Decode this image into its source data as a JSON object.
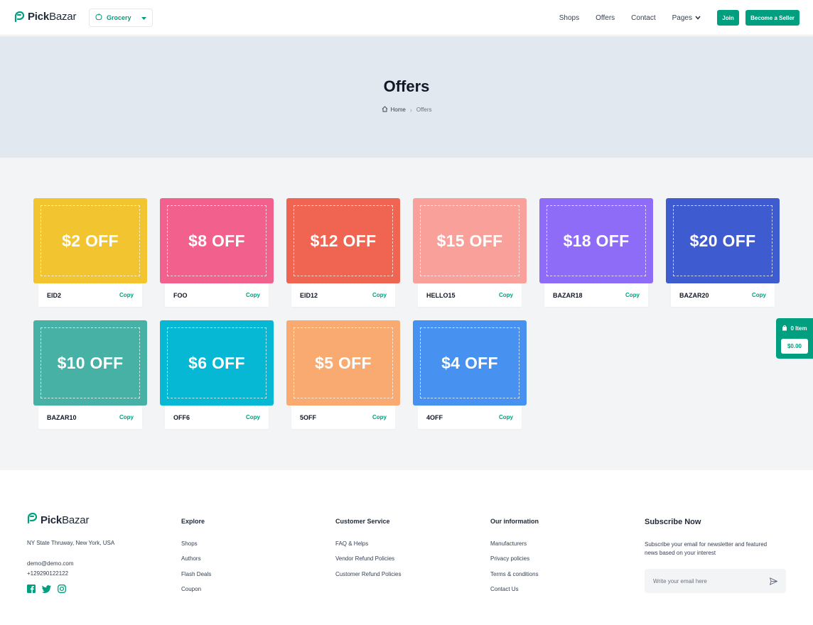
{
  "header": {
    "logo": {
      "text_bold": "Pick",
      "text_regular": "Bazar"
    },
    "category_select": {
      "value": "Grocery"
    },
    "nav": [
      {
        "label": "Shops"
      },
      {
        "label": "Offers"
      },
      {
        "label": "Contact"
      },
      {
        "label": "Pages"
      }
    ],
    "join_label": "Join",
    "seller_label": "Become a Seller"
  },
  "hero": {
    "title": "Offers",
    "breadcrumb": {
      "home": "Home",
      "current": "Offers"
    }
  },
  "coupons": [
    {
      "discount": "$2 OFF",
      "code": "EID2",
      "copy": "Copy",
      "color": "#f2c530"
    },
    {
      "discount": "$8 OFF",
      "code": "FOO",
      "copy": "Copy",
      "color": "#f2608e"
    },
    {
      "discount": "$12 OFF",
      "code": "EID12",
      "copy": "Copy",
      "color": "#ef6551"
    },
    {
      "discount": "$15 OFF",
      "code": "HELLO15",
      "copy": "Copy",
      "color": "#f9a09a"
    },
    {
      "discount": "$18 OFF",
      "code": "BAZAR18",
      "copy": "Copy",
      "color": "#8e6cf8"
    },
    {
      "discount": "$20 OFF",
      "code": "BAZAR20",
      "copy": "Copy",
      "color": "#3f5bd0"
    },
    {
      "discount": "$10 OFF",
      "code": "BAZAR10",
      "copy": "Copy",
      "color": "#46b1a4"
    },
    {
      "discount": "$6 OFF",
      "code": "OFF6",
      "copy": "Copy",
      "color": "#06b8d4"
    },
    {
      "discount": "$5 OFF",
      "code": "5OFF",
      "copy": "Copy",
      "color": "#f8aa70"
    },
    {
      "discount": "$4 OFF",
      "code": "4OFF",
      "copy": "Copy",
      "color": "#4791f1"
    }
  ],
  "cart": {
    "items": "0 Item",
    "total": "$0.00"
  },
  "footer": {
    "logo": {
      "text_bold": "Pick",
      "text_regular": "Bazar"
    },
    "address": "NY State Thruway, New York, USA",
    "email": "demo@demo.com",
    "phone": "+129290122122",
    "columns": [
      {
        "title": "Explore",
        "links": [
          "Shops",
          "Authors",
          "Flash Deals",
          "Coupon"
        ]
      },
      {
        "title": "Customer Service",
        "links": [
          "FAQ & Helps",
          "Vendor Refund Policies",
          "Customer Refund Policies"
        ]
      },
      {
        "title": "Our information",
        "links": [
          "Manufacturers",
          "Privacy policies",
          "Terms & conditions",
          "Contact Us"
        ]
      }
    ],
    "subscribe": {
      "title": "Subscribe Now",
      "description": "Subscribe your email for newsletter and featured news based on your interest",
      "placeholder": "Write your email here"
    }
  },
  "colors": {
    "accent": "#009f7f",
    "hero_bg": "#e2e8f0",
    "offers_bg": "#f3f4f6"
  }
}
